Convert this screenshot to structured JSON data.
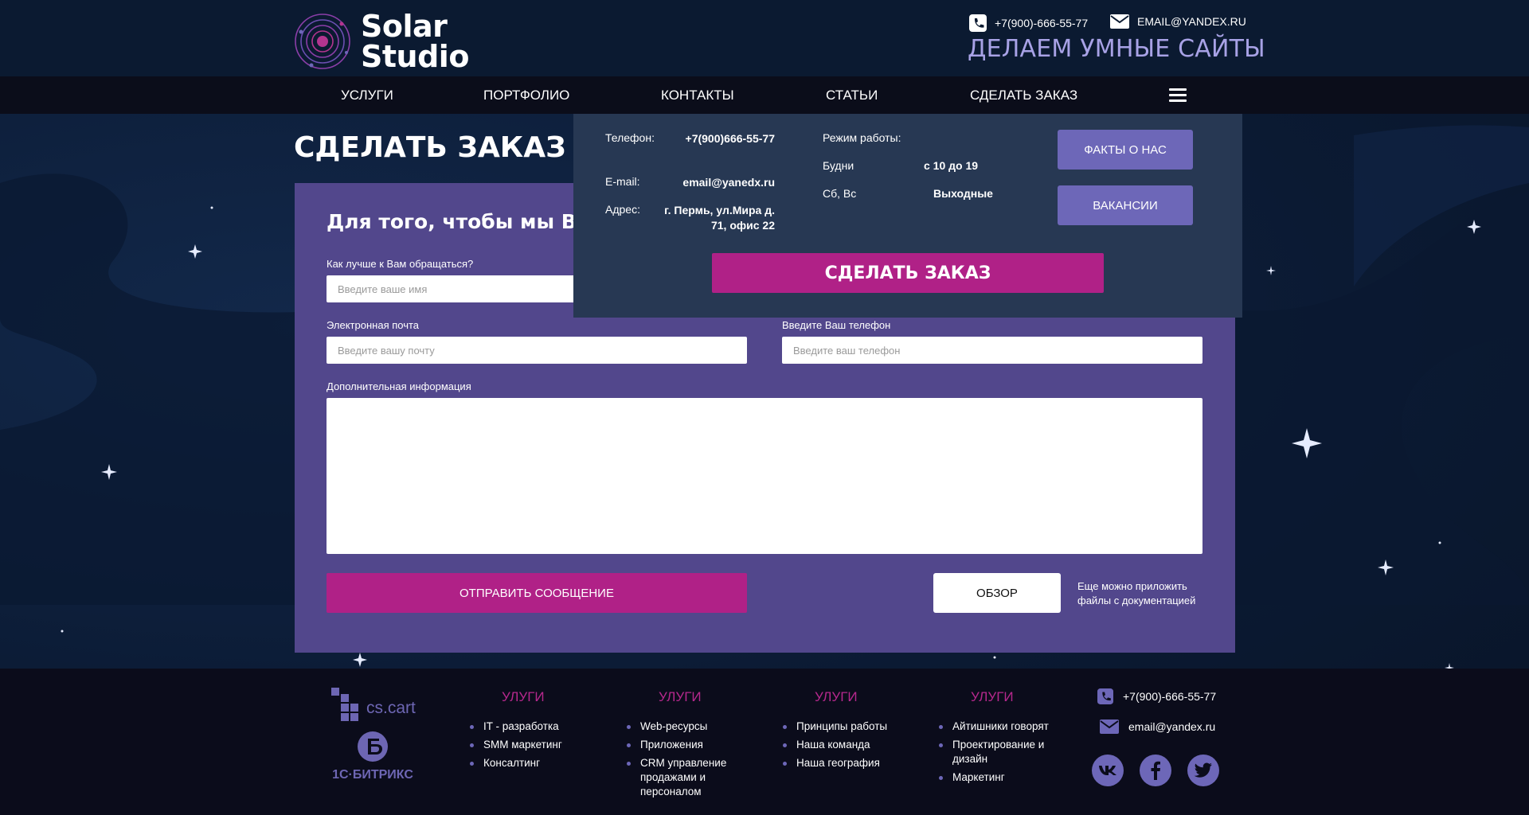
{
  "brand": {
    "name_line1": "Solar",
    "name_line2": "Studio",
    "slogan": "ДЕЛАЕМ УМНЫЕ САЙТЫ"
  },
  "header_contacts": {
    "phone": "+7(900)-666-55-77",
    "email": "EMAIL@YANDEX.RU"
  },
  "nav": {
    "items": [
      "УСЛУГИ",
      "ПОРТФОЛИО",
      "КОНТАКТЫ",
      "СТАТЬИ",
      "СДЕЛАТЬ ЗАКАЗ"
    ]
  },
  "page": {
    "title": "СДЕЛАТЬ ЗАКАЗ"
  },
  "form": {
    "heading": "Для того, чтобы мы Вам",
    "name_label": "Как лучше к Вам обращаться?",
    "name_placeholder": "Введите ваше имя",
    "email_label": "Электронная почта",
    "email_placeholder": "Введите вашу почту",
    "phone_label": "Введите Ваш телефон",
    "phone_placeholder": "Введите ваш телефон",
    "info_label": "Дополнительная информация",
    "send_button": "ОТПРАВИТЬ СООБЩЕНИЕ",
    "browse_button": "ОБЗОР",
    "attach_note": "Еще можно приложить файлы с документацией"
  },
  "dropdown": {
    "phone_label": "Телефон:",
    "phone_value": "+7(900)666-55-77",
    "email_label": "E-mail:",
    "email_value": "email@yanedx.ru",
    "address_label": "Адрес:",
    "address_value": "г. Пермь, ул.Мира д. 71, офис 22",
    "hours_label": "Режим работы:",
    "weekdays_label": "Будни",
    "weekdays_value": "с 10 до 19",
    "weekend_label": "Сб, Вс",
    "weekend_value": "Выходные",
    "facts_button": "ФАКТЫ О НАС",
    "vacancies_button": "ВАКАНСИИ",
    "order_button": "СДЕЛАТЬ ЗАКАЗ"
  },
  "footer": {
    "partners": {
      "cscart": "cs.cart",
      "bitrix": "1С·БИТРИКС"
    },
    "columns": [
      {
        "title": "УЛУГИ",
        "items": [
          "IT - разработка",
          "SMM маркетинг",
          "Консалтинг"
        ]
      },
      {
        "title": "УЛУГИ",
        "items": [
          "Web-ресурсы",
          "Приложения",
          "CRM управление продажами и персоналом"
        ]
      },
      {
        "title": "УЛУГИ",
        "items": [
          "Принципы работы",
          "Наша команда",
          "Наша география"
        ]
      },
      {
        "title": "УЛУГИ",
        "items": [
          "Айтишники говорят",
          "Проектирование и дизайн",
          "Маркетинг"
        ]
      }
    ],
    "phone": "+7(900)-666-55-77",
    "email": "email@yandex.ru",
    "social": [
      "vk-icon",
      "facebook-icon",
      "twitter-icon"
    ]
  },
  "colors": {
    "accent_magenta": "#b02187",
    "accent_purple": "#6d67b8",
    "panel_purple": "#52478c",
    "slogan": "#a8a2e6"
  }
}
